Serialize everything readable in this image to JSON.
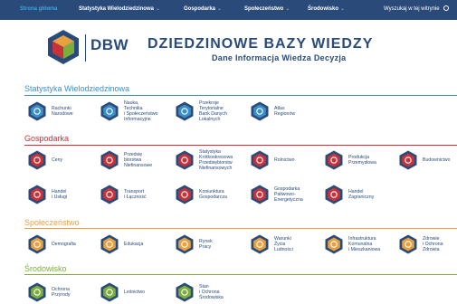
{
  "nav": {
    "items": [
      {
        "label": "Strona główna",
        "active": true,
        "dropdown": false
      },
      {
        "label": "Statystyka Wielodziedzinowa",
        "active": false,
        "dropdown": true
      },
      {
        "label": "Gospodarka",
        "active": false,
        "dropdown": true
      },
      {
        "label": "Społeczeństwo",
        "active": false,
        "dropdown": true
      },
      {
        "label": "Środowisko",
        "active": false,
        "dropdown": true
      }
    ],
    "search_label": "Wyszukaj w tej witrynie"
  },
  "header": {
    "logo_text": "DBW",
    "title": "DZIEDZINOWE BAZY WIEDZY",
    "subtitle": "Dane  Informacja  Wiedza  Decyzja"
  },
  "colors": {
    "navy": "#2a4b7a",
    "blue_section": "#3a8fc8",
    "red_section": "#c8323a",
    "orange_section": "#e8a040",
    "green_section": "#7cae3e"
  },
  "sections": [
    {
      "title": "Statystyka Wielodziedzinowa",
      "color": "#3a8fc8",
      "tiles": [
        {
          "label": "Rachunki\nNarodowe",
          "icon": "ledger-icon"
        },
        {
          "label": "Nauka,\nTechnika\ni Społeczeństwo\nInformacyjne",
          "icon": "flask-icon"
        },
        {
          "label": "Przekroje\nTerytorialne\nBank Danych\nLokalnych",
          "icon": "map-icon"
        },
        {
          "label": "Atlas\nRegionów",
          "icon": "globe-icon"
        }
      ]
    },
    {
      "title": "Gospodarka",
      "color": "#c8323a",
      "tiles": [
        {
          "label": "Ceny",
          "icon": "price-tag-icon"
        },
        {
          "label": "Przedsię\nbiorstwa\nNiefinansowe",
          "icon": "factory-icon"
        },
        {
          "label": "Statystyka\nKrótkookresowa\nPrzedsiębiorstw\nNiefinansowych",
          "icon": "clock-icon"
        },
        {
          "label": "Rolnictwo",
          "icon": "tractor-icon"
        },
        {
          "label": "Produkcja\nPrzemysłowa",
          "icon": "gear-icon"
        },
        {
          "label": "Budownictwo",
          "icon": "crane-icon"
        },
        {
          "label": "Handel\ni Usługi",
          "icon": "cart-icon"
        },
        {
          "label": "Transport\ni Łączność",
          "icon": "truck-icon"
        },
        {
          "label": "Koniunktura\nGospodarcza",
          "icon": "trend-icon"
        },
        {
          "label": "Gospodarka\nPaliwowo-\nEnergetyczna",
          "icon": "bolt-icon"
        },
        {
          "label": "Handel\nZagraniczny",
          "icon": "ship-icon"
        }
      ]
    },
    {
      "title": "Społeczeństwo",
      "color": "#e8a040",
      "tiles": [
        {
          "label": "Demografia",
          "icon": "people-icon"
        },
        {
          "label": "Edukacja",
          "icon": "book-icon"
        },
        {
          "label": "Rynek\nPracy",
          "icon": "briefcase-icon"
        },
        {
          "label": "Warunki\nŻycia\nLudności",
          "icon": "home-icon"
        },
        {
          "label": "Infrastruktura\nKomunalna\ni Mieszkaniowa",
          "icon": "building-icon"
        },
        {
          "label": "Zdrowie\ni Ochrona\nZdrowia",
          "icon": "heart-icon"
        }
      ]
    },
    {
      "title": "Środowisko",
      "color": "#7cae3e",
      "tiles": [
        {
          "label": "Ochrona\nPrzyrody",
          "icon": "leaf-icon"
        },
        {
          "label": "Leśnictwo",
          "icon": "tree-icon"
        },
        {
          "label": "Stan\ni Ochrona\nŚrodowiska",
          "icon": "earth-icon"
        }
      ]
    }
  ]
}
